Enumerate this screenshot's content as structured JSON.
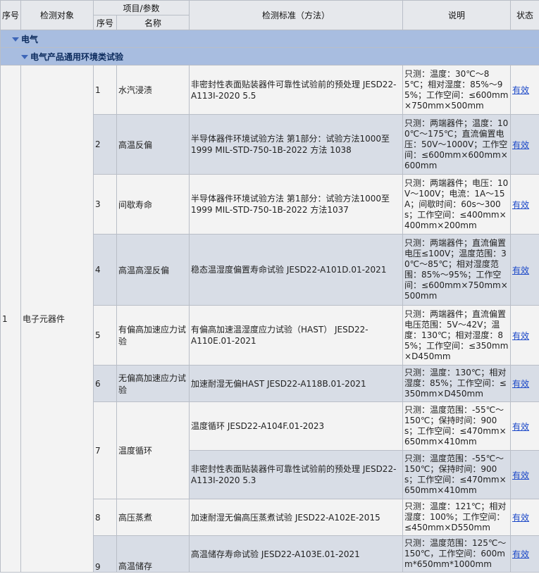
{
  "headers": {
    "seq": "序号",
    "object": "检测对象",
    "item_param": "项目/参数",
    "item_seq": "序号",
    "item_name": "名称",
    "standard": "检测标准（方法）",
    "desc": "说明",
    "status": "状态"
  },
  "sections": {
    "level1": "电气",
    "level2": "电气产品通用环境类试验"
  },
  "group": {
    "seq": "1",
    "object": "电子元器件"
  },
  "rows": [
    {
      "no": "1",
      "name": "水汽浸渍",
      "standard": "非密封性表面贴装器件可靠性试验前的预处理 JESD22-A113I-2020 5.5",
      "desc": "只测：温度：30℃～85℃；相对湿度：85%～95%；工作空间：≤600mm×750mm×500mm",
      "status": "有效"
    },
    {
      "no": "2",
      "name": "高温反偏",
      "standard": "半导体器件环境试验方法 第1部分：试验方法1000至1999 MIL-STD-750-1B-2022 方法 1038",
      "desc": "只测：两端器件；温度：100℃～175℃；直流偏置电压：50V～1000V；工作空间：≤600mm×600mm×600mm",
      "status": "有效"
    },
    {
      "no": "3",
      "name": "间歇寿命",
      "standard": "半导体器件环境试验方法 第1部分：试验方法1000至1999 MIL-STD-750-1B-2022 方法1037",
      "desc": "只测：两端器件；电压：10V～100V；电流：1A～15A；间歇时间：60s～300s；工作空间：≤400mm×400mm×200mm",
      "status": "有效"
    },
    {
      "no": "4",
      "name": "高温高湿反偏",
      "standard": "稳态温湿度偏置寿命试验 JESD22-A101D.01-2021",
      "desc": "只测：两端器件；直流偏置电压≤100V；温度范围：30℃～85℃；相对湿度范围：85%～95%；工作空间：≤600mm×750mm×500mm",
      "status": "有效"
    },
    {
      "no": "5",
      "name": "有偏高加速应力试验",
      "standard": "有偏高加速温湿度应力试验（HAST） JESD22-A110E.01-2021",
      "desc": "只测：两端器件；直流偏置电压范围：5V～42V；温度：130℃；相对湿度：85%；工作空间：≤350mm×D450mm",
      "status": "有效"
    },
    {
      "no": "6",
      "name": "无偏高加速应力试验",
      "standard": "加速耐湿无偏HAST JESD22-A118B.01-2021",
      "desc": "只测：温度：130℃；相对湿度：85%；工作空间：≤350mm×D450mm",
      "status": "有效"
    },
    {
      "no": "7",
      "name": "温度循环",
      "standard": "温度循环 JESD22-A104F.01-2023",
      "desc": "只测：温度范围：-55℃～150℃；保持时间：900s；工作空间：≤470mm×650mm×410mm",
      "status": "有效"
    },
    {
      "standard": "非密封性表面贴装器件可靠性试验前的预处理 JESD22-A113I-2020 5.3",
      "desc": "只测：温度范围：-55℃～150℃；保持时间：900s；工作空间：≤470mm×650mm×410mm",
      "status": "有效"
    },
    {
      "no": "8",
      "name": "高压蒸煮",
      "standard": "加速耐湿无偏高压蒸煮试验 JESD22-A102E-2015",
      "desc": "只测：温度：121℃；相对湿度：100%；工作空间：≤450mm×D550mm",
      "status": "有效"
    },
    {
      "no": "9",
      "name": "高温储存",
      "standard": "高温储存寿命试验 JESD22-A103E.01-2021",
      "desc": "只测：温度范围：125℃～150℃，工作空间：600mm*650mm*1000mm",
      "status": "有效"
    }
  ]
}
